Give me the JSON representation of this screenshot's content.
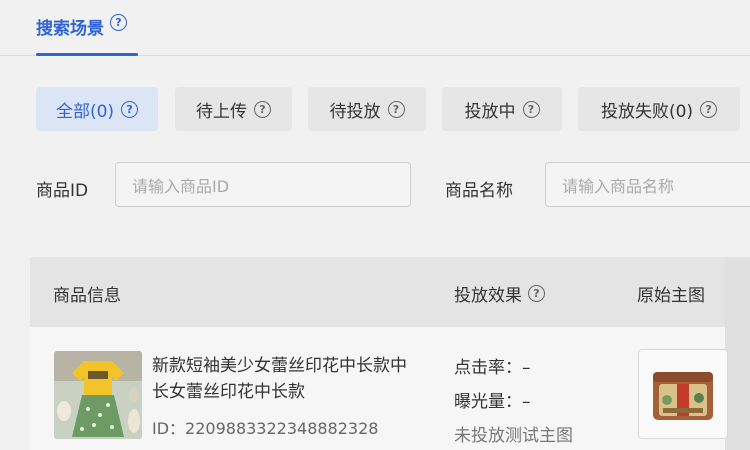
{
  "scene_tab": {
    "label": "搜索场景",
    "help_icon": "question-circle-icon"
  },
  "status_tabs": [
    {
      "label": "全部(0)",
      "active": true
    },
    {
      "label": "待上传",
      "active": false
    },
    {
      "label": "待投放",
      "active": false
    },
    {
      "label": "投放中",
      "active": false
    },
    {
      "label": "投放失败(0)",
      "active": false
    }
  ],
  "filters": {
    "product_id": {
      "label": "商品ID",
      "placeholder": "请输入商品ID"
    },
    "product_name": {
      "label": "商品名称",
      "placeholder": "请输入商品名称"
    }
  },
  "table": {
    "headers": {
      "info": "商品信息",
      "effect": "投放效果",
      "original": "原始主图"
    },
    "rows": [
      {
        "title": "新款短袖美少女蕾丝印花中长款中长女蕾丝印花中长款",
        "id": "ID：2209883322348882328",
        "ctr": "点击率：–",
        "exposure": "曝光量：–",
        "note": "未投放测试主图"
      }
    ]
  },
  "colors": {
    "accent": "#2f63d6",
    "active_tab_bg": "#dbe5f6",
    "tab_bg": "#e6e6e6"
  }
}
